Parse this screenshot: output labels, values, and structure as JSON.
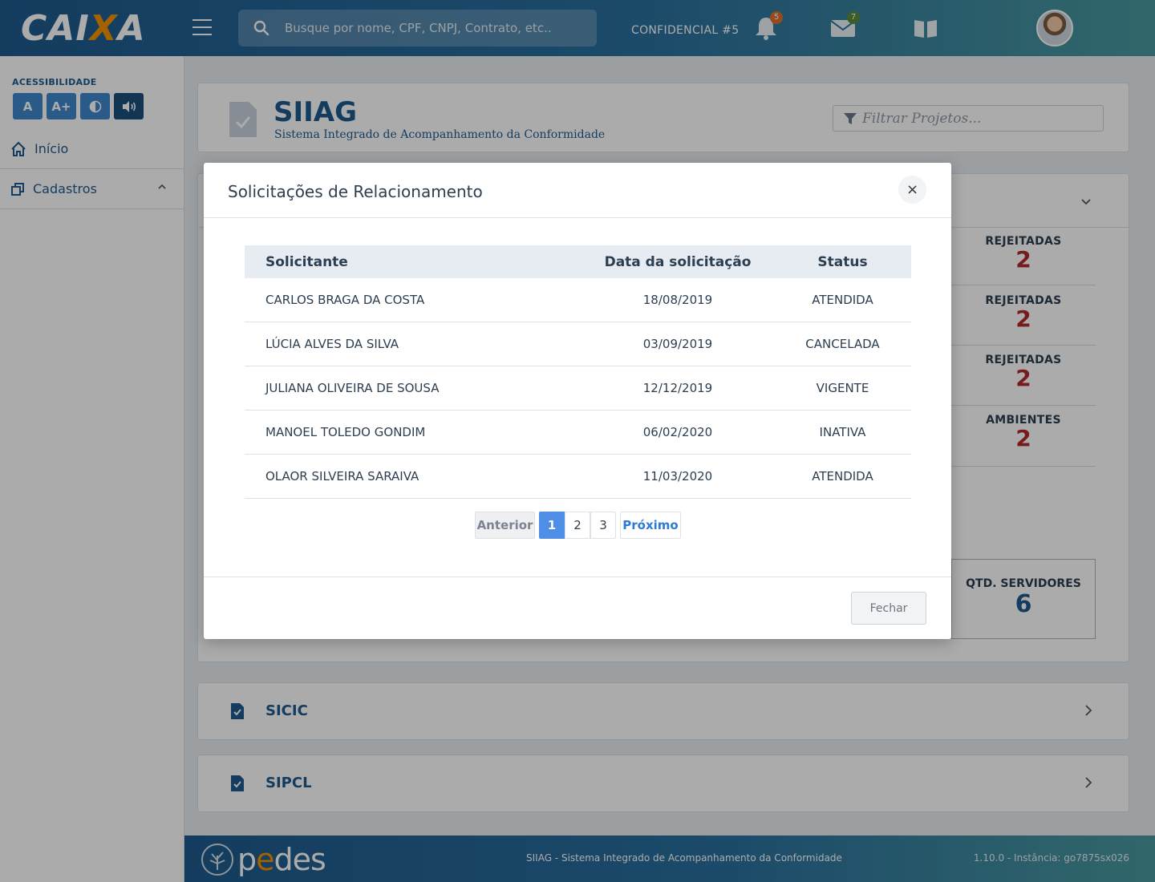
{
  "brand": {
    "logo_pre": "CAI",
    "logo_x": "X",
    "logo_post": "A",
    "accent": "#f39200",
    "primary": "#1e5a8e"
  },
  "header": {
    "search_placeholder": "Busque por nome, CPF, CNPJ, Contrato, etc..",
    "confidential_label": "CONFIDENCIAL #5",
    "notifications_count": "5",
    "messages_count": "7",
    "icons": [
      "menu-icon",
      "search-icon",
      "bell-icon",
      "mail-icon",
      "book-icon"
    ]
  },
  "sidebar": {
    "accessibility_label": "ACESSIBILIDADE",
    "accessibility_buttons": [
      "A",
      "A+"
    ],
    "items": [
      {
        "label": "Início",
        "icon": "home-icon"
      },
      {
        "label": "Cadastros",
        "icon": "copy-icon"
      }
    ]
  },
  "project": {
    "title": "SIIAG",
    "subtitle": "Sistema Integrado de Acompanhamento da Conformidade",
    "filter_placeholder": "Filtrar Projetos..."
  },
  "stats": [
    {
      "label": "REJEITADAS",
      "value": "2"
    },
    {
      "label": "REJEITADAS",
      "value": "2"
    },
    {
      "label": "REJEITADAS",
      "value": "2"
    },
    {
      "label": "AMBIENTES",
      "value": "2"
    }
  ],
  "servers": {
    "label": "QTD. SERVIDORES",
    "value": "6"
  },
  "systems": [
    {
      "name": "SICIC"
    },
    {
      "name": "SIPCL"
    }
  ],
  "modal": {
    "title": "Solicitações de Relacionamento",
    "close_glyph": "×",
    "columns": [
      "Solicitante",
      "Data da solicitação",
      "Status"
    ],
    "rows": [
      {
        "name": "CARLOS BRAGA DA COSTA",
        "date": "18/08/2019",
        "status": "ATENDIDA"
      },
      {
        "name": "LÚCIA ALVES DA SILVA",
        "date": "03/09/2019",
        "status": "CANCELADA"
      },
      {
        "name": "JULIANA OLIVEIRA DE SOUSA",
        "date": "12/12/2019",
        "status": "VIGENTE"
      },
      {
        "name": "MANOEL TOLEDO GONDIM",
        "date": "06/02/2020",
        "status": "INATIVA"
      },
      {
        "name": "OLAOR SILVEIRA SARAIVA",
        "date": "11/03/2020",
        "status": "ATENDIDA"
      }
    ],
    "pagination": {
      "prev": "Anterior",
      "pages": [
        "1",
        "2",
        "3"
      ],
      "current": "1",
      "next": "Próximo"
    },
    "close_button": "Fechar"
  },
  "footer": {
    "brand_pre": "p",
    "brand_e": "e",
    "brand_post": "des",
    "system_text": "SIIAG  - Sistema Integrado de Acompanhamento da Conformidade",
    "version_text": "1.10.0 - Instância: go7875sx026"
  }
}
